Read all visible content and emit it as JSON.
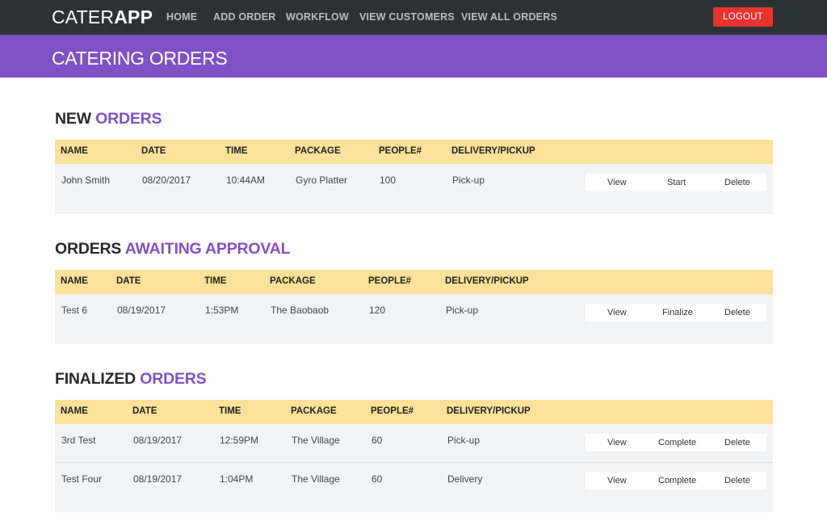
{
  "app": {
    "brand_light": "CATER",
    "brand_bold": "APP"
  },
  "nav": {
    "items": [
      "HOME",
      "ADD ORDER",
      "WORKFLOW",
      "VIEW CUSTOMERS",
      "VIEW ALL ORDERS"
    ],
    "logout_label": "LOGOUT"
  },
  "page": {
    "title": "CATERING ORDERS"
  },
  "colors": {
    "topbar": "#2b3236",
    "titlebar": "#7f51c4",
    "accent": "#8250c6",
    "header_row": "#fbe199",
    "logout": "#e8332e",
    "row_bg": "#f2f3f4"
  },
  "sections": [
    {
      "title_dark": "NEW ",
      "title_accent": "ORDERS",
      "columns": [
        "NAME",
        "DATE",
        "TIME",
        "PACKAGE",
        "PEOPLE#",
        "DELIVERY/PICKUP"
      ],
      "rows": [
        {
          "name": "John Smith",
          "date": "08/20/2017",
          "time": "10:44AM",
          "package": "Gyro Platter",
          "people": "100",
          "delivery": "Pick-up",
          "actions": [
            "View",
            "Start",
            "Delete"
          ]
        }
      ]
    },
    {
      "title_dark": "ORDERS ",
      "title_accent": "AWAITING APPROVAL",
      "columns": [
        "NAME",
        "DATE",
        "TIME",
        "PACKAGE",
        "PEOPLE#",
        "DELIVERY/PICKUP"
      ],
      "rows": [
        {
          "name": "Test 6",
          "date": "08/19/2017",
          "time": "1:53PM",
          "package": "The Baobaob",
          "people": "120",
          "delivery": "Pick-up",
          "actions": [
            "View",
            "Finalize",
            "Delete"
          ]
        }
      ]
    },
    {
      "title_dark": "FINALIZED ",
      "title_accent": "ORDERS",
      "columns": [
        "NAME",
        "DATE",
        "TIME",
        "PACKAGE",
        "PEOPLE#",
        "DELIVERY/PICKUP"
      ],
      "rows": [
        {
          "name": "3rd Test",
          "date": "08/19/2017",
          "time": "12:59PM",
          "package": "The Village",
          "people": "60",
          "delivery": "Pick-up",
          "actions": [
            "View",
            "Complete",
            "Delete"
          ]
        },
        {
          "name": "Test Four",
          "date": "08/19/2017",
          "time": "1:04PM",
          "package": "The Village",
          "people": "60",
          "delivery": "Delivery",
          "actions": [
            "View",
            "Complete",
            "Delete"
          ]
        }
      ]
    }
  ]
}
